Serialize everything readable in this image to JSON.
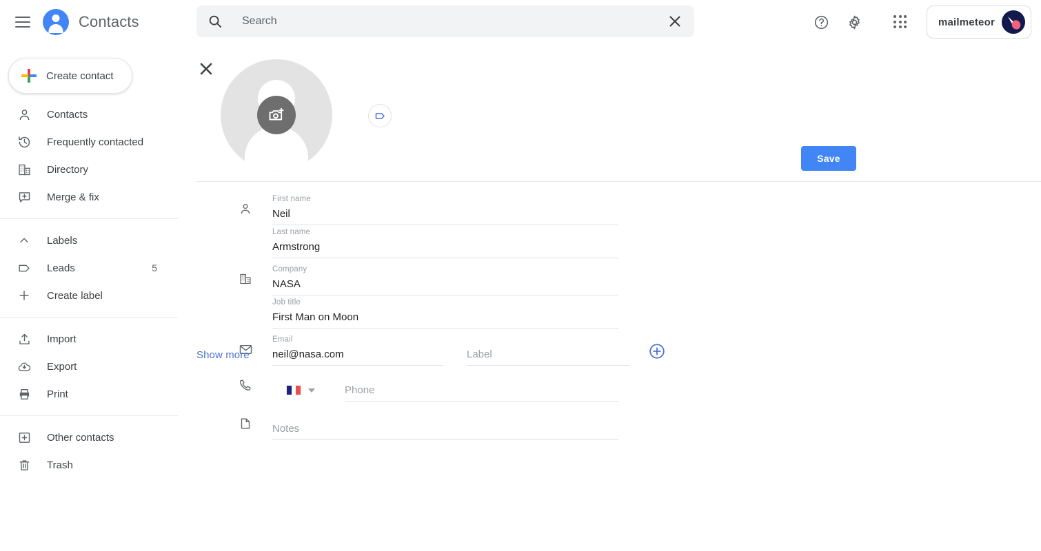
{
  "app": {
    "title": "Contacts",
    "menu_icon": "hamburger-icon",
    "logo_icon": "contacts-logo-icon"
  },
  "search": {
    "placeholder": "Search",
    "value": "",
    "icon": "search-icon",
    "clear_icon": "close-icon"
  },
  "header": {
    "help_icon": "help-icon",
    "settings_icon": "gear-icon",
    "apps_icon": "apps-grid-icon",
    "account_name": "mailmeteor",
    "account_avatar_icon": "avatar-icon"
  },
  "sidebar": {
    "create_contact": {
      "label": "Create contact",
      "icon": "plus-icon"
    },
    "groups": [
      {
        "items": [
          {
            "label": "Contacts",
            "icon": "person-icon",
            "count": ""
          },
          {
            "label": "Frequently contacted",
            "icon": "history-icon",
            "count": ""
          },
          {
            "label": "Directory",
            "icon": "building-icon",
            "count": ""
          },
          {
            "label": "Merge & fix",
            "icon": "merge-fix-icon",
            "count": ""
          }
        ]
      },
      {
        "items": [
          {
            "label": "Labels",
            "icon": "chevron-up-icon",
            "count": ""
          },
          {
            "label": "Leads",
            "icon": "label-tag-icon",
            "count": "5"
          },
          {
            "label": "Create label",
            "icon": "plus-icon",
            "count": ""
          }
        ]
      },
      {
        "items": [
          {
            "label": "Import",
            "icon": "import-icon",
            "count": ""
          },
          {
            "label": "Export",
            "icon": "export-cloud-icon",
            "count": ""
          },
          {
            "label": "Print",
            "icon": "print-icon",
            "count": ""
          }
        ]
      },
      {
        "items": [
          {
            "label": "Other contacts",
            "icon": "other-contacts-icon",
            "count": ""
          },
          {
            "label": "Trash",
            "icon": "trash-icon",
            "count": ""
          }
        ]
      }
    ]
  },
  "contact_editor": {
    "close_icon": "close-icon",
    "photo": {
      "placeholder_icon": "person-placeholder-icon",
      "camera_icon": "add-photo-camera-icon"
    },
    "tag_button_icon": "label-tag-icon",
    "save_label": "Save",
    "save_color": "#4285f4",
    "fields": {
      "first_name": {
        "label": "First name",
        "value": "Neil",
        "icon": "person-icon"
      },
      "last_name": {
        "label": "Last name",
        "value": "Armstrong"
      },
      "company": {
        "label": "Company",
        "value": "NASA",
        "icon": "building-icon"
      },
      "job_title": {
        "label": "Job title",
        "value": "First Man on Moon"
      },
      "email": {
        "label": "Email",
        "value": "neil@nasa.com",
        "icon": "email-icon"
      },
      "email_label": {
        "label": "",
        "placeholder": "Label"
      },
      "phone": {
        "placeholder": "Phone",
        "icon": "phone-icon",
        "country_flag": "flag-france",
        "country_caret": "chevron-down-icon"
      },
      "notes": {
        "placeholder": "Notes",
        "icon": "note-icon"
      }
    },
    "add_email_icon": "add-circle-icon",
    "show_more_label": "Show more",
    "link_color": "#4b72d4"
  }
}
